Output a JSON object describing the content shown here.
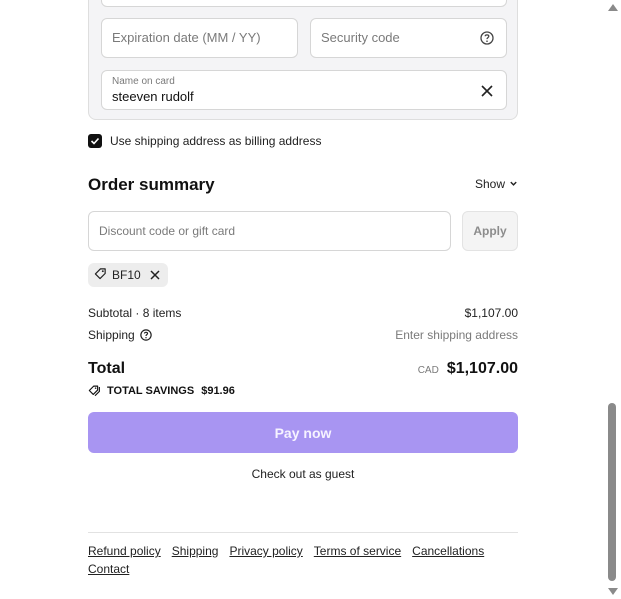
{
  "card": {
    "expiration_placeholder": "Expiration date (MM / YY)",
    "security_placeholder": "Security code",
    "name_label": "Name on card",
    "name_value": "steeven rudolf"
  },
  "billing_checkbox": {
    "label": "Use shipping address as billing address",
    "checked": true
  },
  "order_summary": {
    "title": "Order summary",
    "toggle_label": "Show",
    "discount_placeholder": "Discount code or gift card",
    "apply_label": "Apply",
    "applied_code": "BF10",
    "subtotal_label": "Subtotal · 8 items",
    "subtotal_value": "$1,107.00",
    "shipping_label": "Shipping",
    "shipping_value": "Enter shipping address",
    "total_label": "Total",
    "total_currency": "CAD",
    "total_value": "$1,107.00",
    "savings_label": "TOTAL SAVINGS",
    "savings_value": "$91.96"
  },
  "actions": {
    "pay_label": "Pay now",
    "guest_label": "Check out as guest"
  },
  "footer": {
    "links": [
      "Refund policy",
      "Shipping",
      "Privacy policy",
      "Terms of service",
      "Cancellations",
      "Contact"
    ]
  },
  "colors": {
    "pay_button": "#a895f2",
    "panel_bg": "#f4f4f6"
  },
  "icons": {
    "help": "question-circle-icon",
    "clear": "close-icon",
    "tag": "tag-icon",
    "chevron": "chevron-down-icon"
  }
}
